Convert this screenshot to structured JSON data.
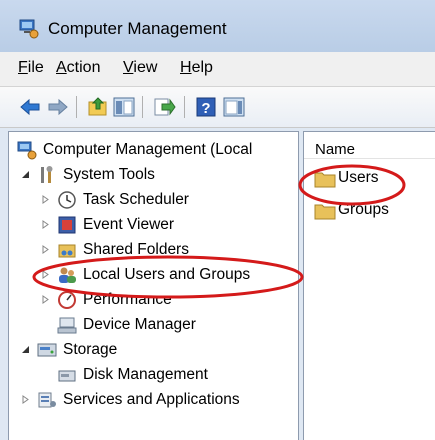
{
  "window": {
    "title": "Computer Management"
  },
  "menu": {
    "items": [
      {
        "accel": "F",
        "rest": "ile"
      },
      {
        "accel": "A",
        "rest": "ction"
      },
      {
        "accel": "V",
        "rest": "iew"
      },
      {
        "accel": "H",
        "rest": "elp"
      }
    ]
  },
  "toolbar": {
    "icons": [
      "back-arrow-icon",
      "forward-arrow-icon",
      "up-folder-icon",
      "show-hide-console-tree-icon",
      "export-list-icon",
      "help-icon",
      "show-action-pane-icon"
    ]
  },
  "tree": {
    "root": "Computer Management (Local",
    "system_tools": "System Tools",
    "task_scheduler": "Task Scheduler",
    "event_viewer": "Event Viewer",
    "shared_folders": "Shared Folders",
    "local_users_groups": "Local Users and Groups",
    "performance": "Performance",
    "device_manager": "Device Manager",
    "storage": "Storage",
    "disk_management": "Disk Management",
    "services_apps": "Services and Applications"
  },
  "list": {
    "column_name": "Name",
    "items": [
      "Users",
      "Groups"
    ]
  },
  "colors": {
    "highlight_annotation": "#d41a1a",
    "folder": "#e8c15a"
  }
}
